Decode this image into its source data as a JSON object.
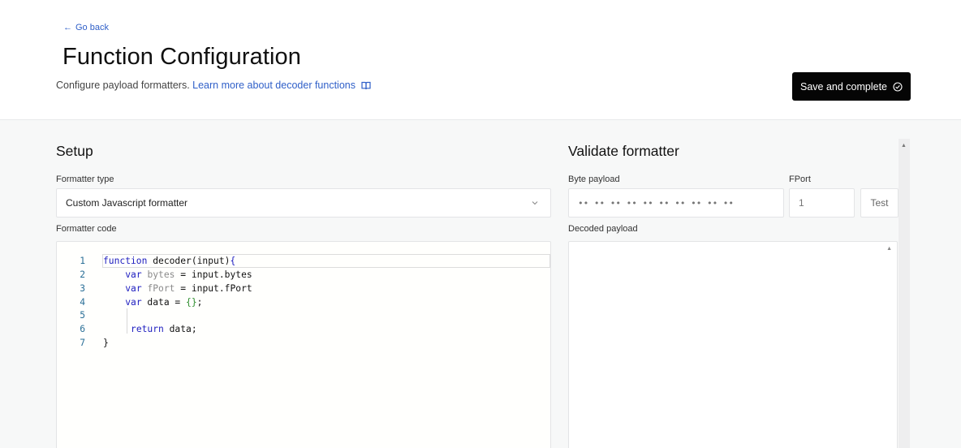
{
  "header": {
    "go_back": "Go back",
    "title": "Function Configuration",
    "subtitle": "Configure payload formatters.",
    "learn_link": "Learn more about decoder functions",
    "save_button": "Save and complete"
  },
  "setup": {
    "title": "Setup",
    "formatter_type_label": "Formatter type",
    "formatter_type_value": "Custom Javascript formatter",
    "formatter_code_label": "Formatter code",
    "code_lines": [
      {
        "n": "1",
        "text": "function decoder(input){"
      },
      {
        "n": "2",
        "text": "    var bytes = input.bytes"
      },
      {
        "n": "3",
        "text": "    var fPort = input.fPort"
      },
      {
        "n": "4",
        "text": "    var data = {};"
      },
      {
        "n": "5",
        "text": ""
      },
      {
        "n": "6",
        "text": "     return data;"
      },
      {
        "n": "7",
        "text": "}"
      }
    ]
  },
  "validate": {
    "title": "Validate formatter",
    "byte_payload_label": "Byte payload",
    "byte_payload_placeholder": "•• •• •• •• •• •• •• •• •• ••",
    "fport_label": "FPort",
    "fport_placeholder": "1",
    "test_button": "Test",
    "decoded_payload_label": "Decoded payload"
  },
  "icons": {
    "back": "arrow-left-icon",
    "book": "book-open-icon",
    "check": "check-circle-icon",
    "chevron": "chevron-down-icon"
  },
  "colors": {
    "link": "#2f5fc8",
    "button_bg": "#050505",
    "keyword": "#2020c0"
  }
}
